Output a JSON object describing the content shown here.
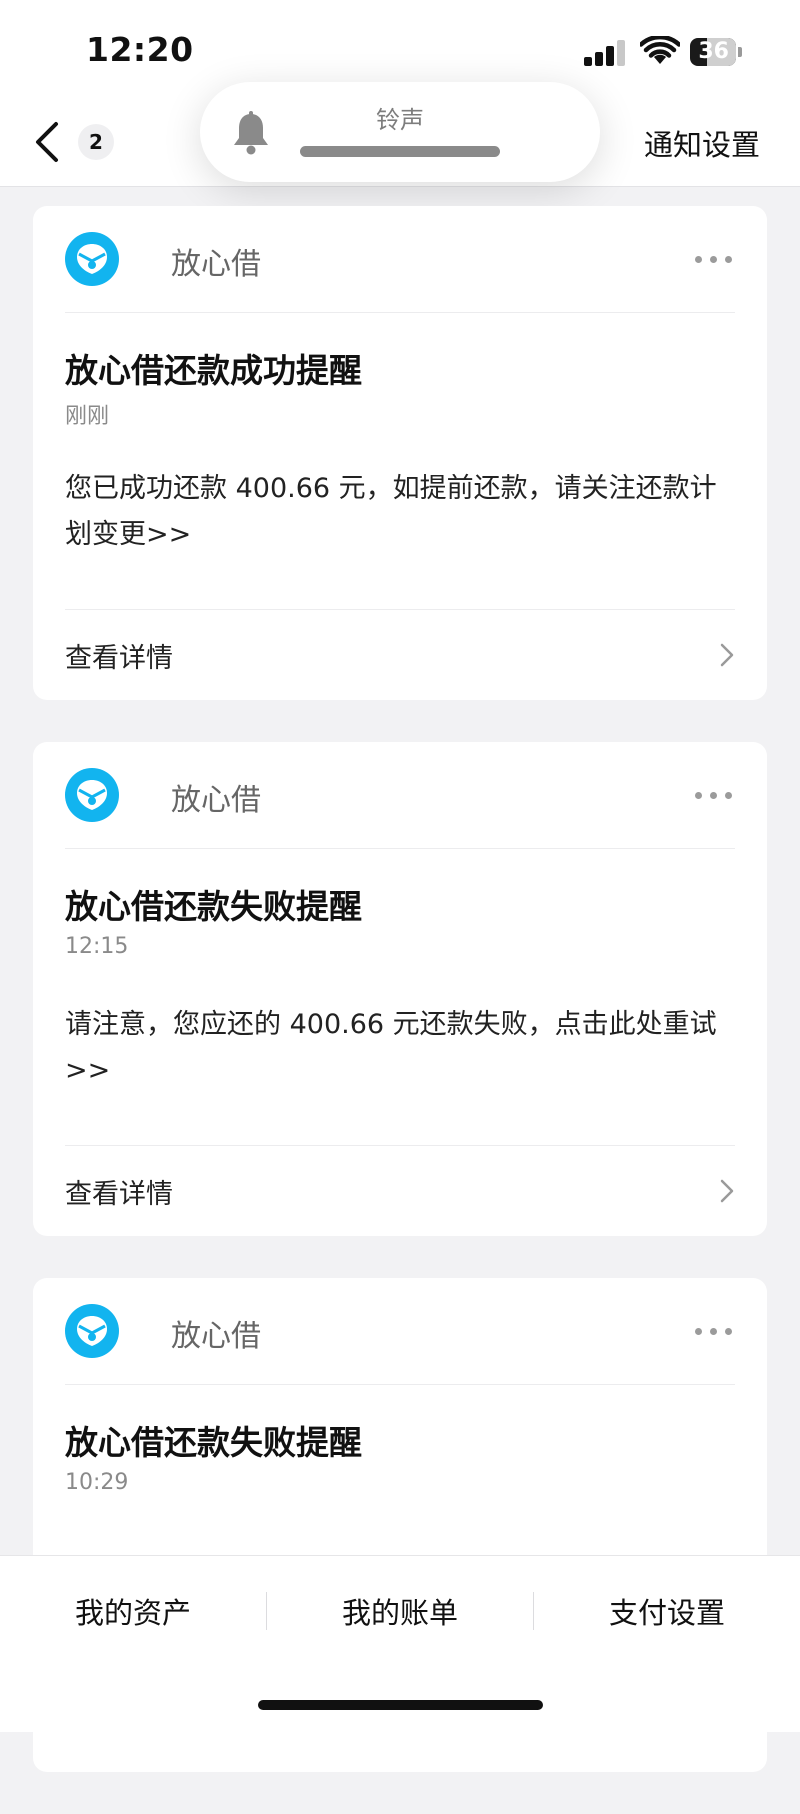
{
  "status_bar": {
    "time": "12:20",
    "battery": "36",
    "battery_level": 0.36
  },
  "header": {
    "back_count": "2",
    "settings_label": "通知设置"
  },
  "ringer": {
    "label": "铃声"
  },
  "colors": {
    "brand": "#12b4ef",
    "page_bg": "#f2f2f4"
  },
  "cards": [
    {
      "app_name": "放心借",
      "title": "放心借还款成功提醒",
      "time": "刚刚",
      "body": "您已成功还款 400.66 元，如提前还款，请关注还款计划变更>>",
      "detail_label": "查看详情"
    },
    {
      "app_name": "放心借",
      "title": "放心借还款失败提醒",
      "time": "12:15",
      "body": "请注意，您应还的 400.66 元还款失败，点击此处重试>>",
      "detail_label": "查看详情"
    },
    {
      "app_name": "放心借",
      "title": "放心借还款失败提醒",
      "time": "10:29",
      "body": "",
      "detail_label": ""
    }
  ],
  "tabbar": {
    "tabs": [
      {
        "label": "我的资产"
      },
      {
        "label": "我的账单"
      },
      {
        "label": "支付设置"
      }
    ]
  }
}
